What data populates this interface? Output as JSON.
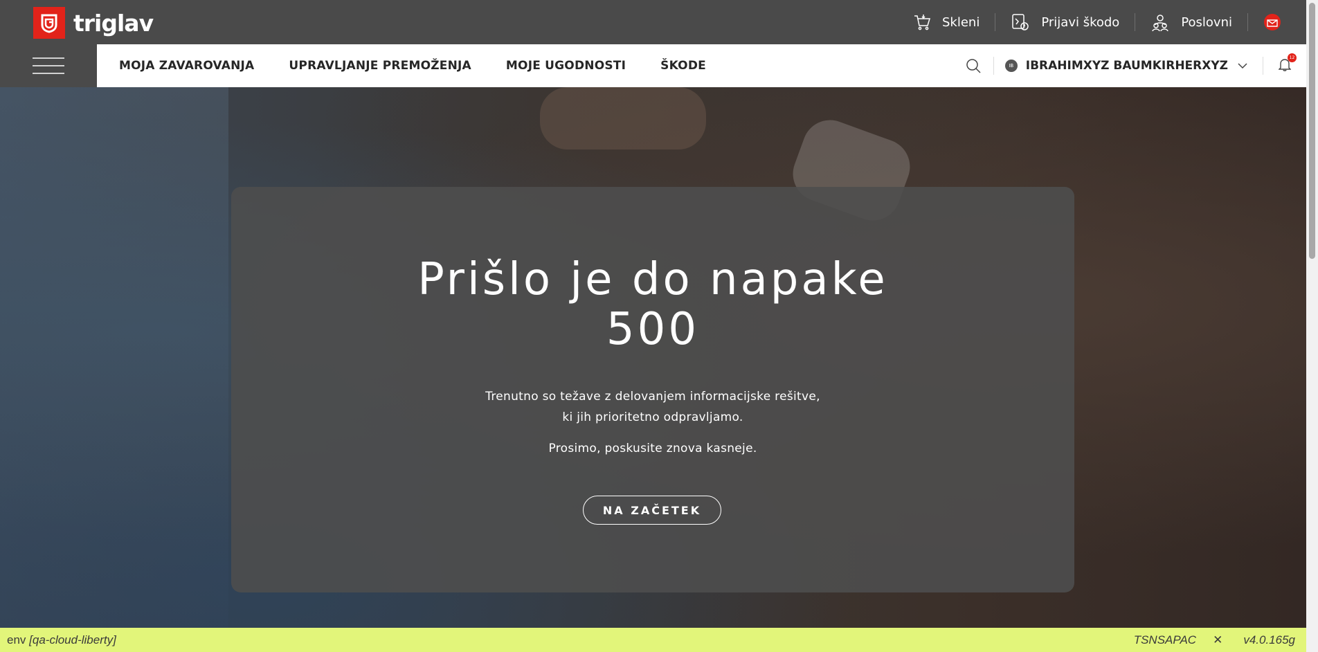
{
  "brand": {
    "name": "triglav",
    "color": "#e2231a"
  },
  "topnav": [
    {
      "label": "Skleni",
      "icon": "cart-icon"
    },
    {
      "label": "Prijavi škodo",
      "icon": "claim-icon"
    },
    {
      "label": "Poslovni",
      "icon": "users-icon"
    }
  ],
  "mainnav": [
    {
      "label": "MOJA ZAVAROVANJA"
    },
    {
      "label": "UPRAVLJANJE PREMOŽENJA"
    },
    {
      "label": "MOJE UGODNOSTI"
    },
    {
      "label": "ŠKODE"
    }
  ],
  "user": {
    "initials": "IB",
    "name": "IBRAHIMXYZ BAUMKIRHERXYZ"
  },
  "notifications": {
    "count": "12"
  },
  "error": {
    "title_line1": "Prišlo je do napake",
    "title_line2": "500",
    "text_line1": "Trenutno so težave z delovanjem informacijske rešitve,",
    "text_line2": "ki jih prioritetno odpravljamo.",
    "text_line3": "Prosimo, poskusite znova kasneje.",
    "button": "NA ZAČETEK"
  },
  "env": {
    "label": "env",
    "name": "[qa-cloud-liberty]",
    "code": "TSNSAPAC",
    "close": "✕",
    "version": "v4.0.165g",
    "bar_color": "#e2f57a"
  }
}
